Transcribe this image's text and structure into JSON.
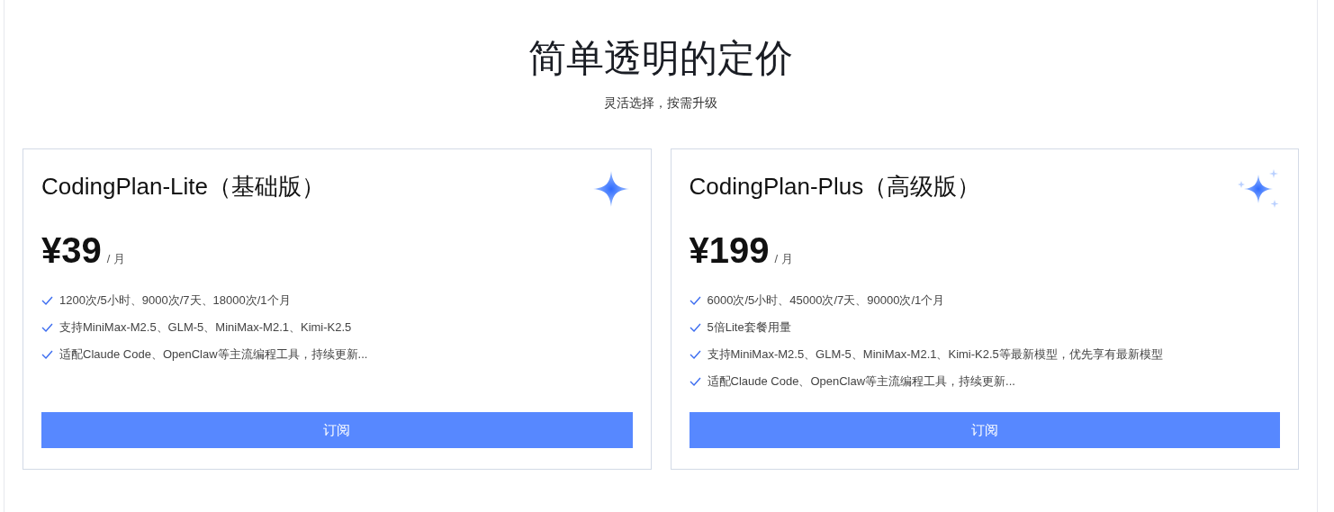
{
  "heading": "简单透明的定价",
  "subheading": "灵活选择，按需升级",
  "plans": [
    {
      "kind": "basic",
      "name": "CodingPlan-Lite（基础版）",
      "price": "¥39",
      "period": "/ 月",
      "features": [
        "1200次/5小时、9000次/7天、18000次/1个月",
        "支持MiniMax-M2.5、GLM-5、MiniMax-M2.1、Kimi-K2.5",
        "适配Claude Code、OpenClaw等主流编程工具，持续更新..."
      ],
      "button": "订阅"
    },
    {
      "kind": "premium",
      "name": "CodingPlan-Plus（高级版）",
      "price": "¥199",
      "period": "/ 月",
      "features": [
        "6000次/5小时、45000次/7天、90000次/1个月",
        "5倍Lite套餐用量",
        "支持MiniMax-M2.5、GLM-5、MiniMax-M2.1、Kimi-K2.5等最新模型，优先享有最新模型",
        "适配Claude Code、OpenClaw等主流编程工具，持续更新..."
      ],
      "button": "订阅"
    }
  ]
}
